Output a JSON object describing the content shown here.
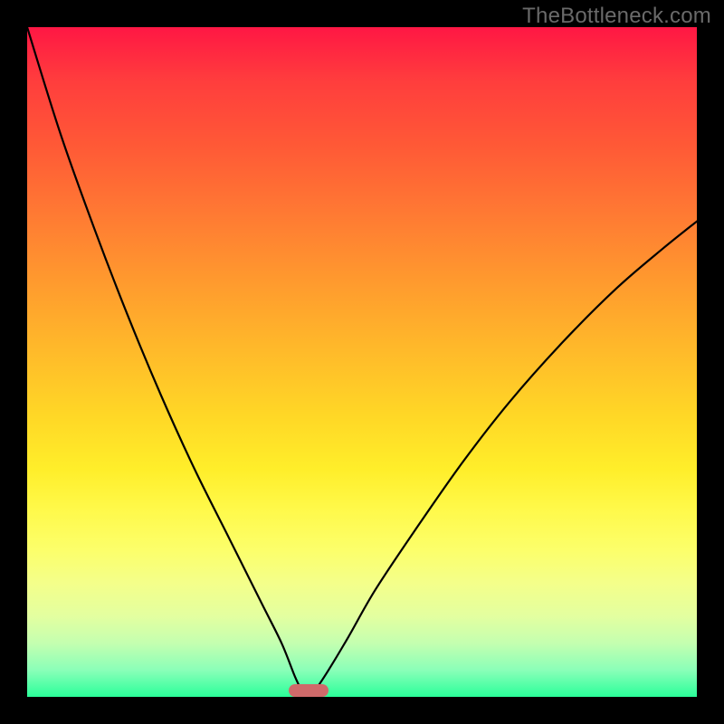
{
  "domain": "Chart",
  "watermark": "TheBottleneck.com",
  "colors": {
    "frame": "#000000",
    "curve": "#000000",
    "marker": "#cf6a6a",
    "gradient_stops": [
      "#ff1744",
      "#ff3d3d",
      "#ff5a36",
      "#ff7a33",
      "#ff9a2e",
      "#ffb92a",
      "#ffd726",
      "#ffee2a",
      "#fff94a",
      "#fcff6a",
      "#f4ff8a",
      "#e3ffa0",
      "#c4ffb0",
      "#8affb8",
      "#2aff9a"
    ]
  },
  "chart_data": {
    "type": "line",
    "title": "",
    "xlabel": "",
    "ylabel": "",
    "xlim": [
      0,
      100
    ],
    "ylim": [
      0,
      100
    ],
    "grid": false,
    "legend": false,
    "series": [
      {
        "name": "bottleneck-curve",
        "x": [
          0,
          5,
          10,
          15,
          20,
          25,
          30,
          35,
          38,
          40,
          41,
          42,
          43,
          45,
          48,
          52,
          58,
          65,
          72,
          80,
          88,
          95,
          100
        ],
        "y": [
          100,
          84,
          70,
          57,
          45,
          34,
          24,
          14,
          8,
          3,
          1,
          0,
          1,
          4,
          9,
          16,
          25,
          35,
          44,
          53,
          61,
          67,
          71
        ]
      }
    ],
    "marker": {
      "x_center": 42,
      "y": 0,
      "width_pct": 6
    },
    "notes": "V-shaped curve with minimum near x≈42; background is vertical red→green gradient; values estimated from pixel positions (no axis ticks present)."
  }
}
